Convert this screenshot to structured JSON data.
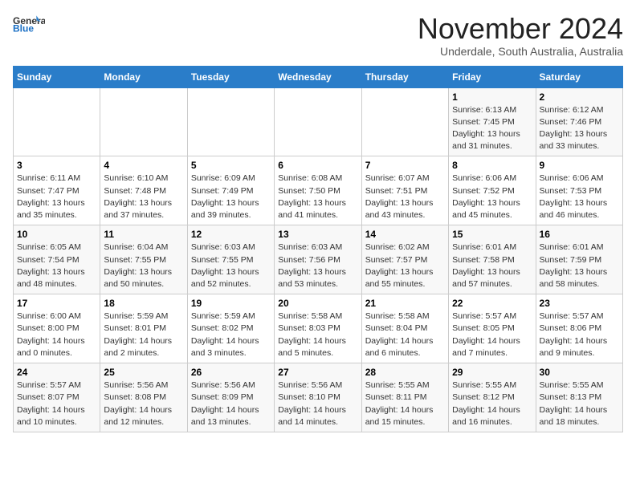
{
  "logo": {
    "general": "General",
    "blue": "Blue"
  },
  "title": "November 2024",
  "subtitle": "Underdale, South Australia, Australia",
  "headers": [
    "Sunday",
    "Monday",
    "Tuesday",
    "Wednesday",
    "Thursday",
    "Friday",
    "Saturday"
  ],
  "weeks": [
    [
      {
        "day": "",
        "detail": ""
      },
      {
        "day": "",
        "detail": ""
      },
      {
        "day": "",
        "detail": ""
      },
      {
        "day": "",
        "detail": ""
      },
      {
        "day": "",
        "detail": ""
      },
      {
        "day": "1",
        "detail": "Sunrise: 6:13 AM\nSunset: 7:45 PM\nDaylight: 13 hours\nand 31 minutes."
      },
      {
        "day": "2",
        "detail": "Sunrise: 6:12 AM\nSunset: 7:46 PM\nDaylight: 13 hours\nand 33 minutes."
      }
    ],
    [
      {
        "day": "3",
        "detail": "Sunrise: 6:11 AM\nSunset: 7:47 PM\nDaylight: 13 hours\nand 35 minutes."
      },
      {
        "day": "4",
        "detail": "Sunrise: 6:10 AM\nSunset: 7:48 PM\nDaylight: 13 hours\nand 37 minutes."
      },
      {
        "day": "5",
        "detail": "Sunrise: 6:09 AM\nSunset: 7:49 PM\nDaylight: 13 hours\nand 39 minutes."
      },
      {
        "day": "6",
        "detail": "Sunrise: 6:08 AM\nSunset: 7:50 PM\nDaylight: 13 hours\nand 41 minutes."
      },
      {
        "day": "7",
        "detail": "Sunrise: 6:07 AM\nSunset: 7:51 PM\nDaylight: 13 hours\nand 43 minutes."
      },
      {
        "day": "8",
        "detail": "Sunrise: 6:06 AM\nSunset: 7:52 PM\nDaylight: 13 hours\nand 45 minutes."
      },
      {
        "day": "9",
        "detail": "Sunrise: 6:06 AM\nSunset: 7:53 PM\nDaylight: 13 hours\nand 46 minutes."
      }
    ],
    [
      {
        "day": "10",
        "detail": "Sunrise: 6:05 AM\nSunset: 7:54 PM\nDaylight: 13 hours\nand 48 minutes."
      },
      {
        "day": "11",
        "detail": "Sunrise: 6:04 AM\nSunset: 7:55 PM\nDaylight: 13 hours\nand 50 minutes."
      },
      {
        "day": "12",
        "detail": "Sunrise: 6:03 AM\nSunset: 7:55 PM\nDaylight: 13 hours\nand 52 minutes."
      },
      {
        "day": "13",
        "detail": "Sunrise: 6:03 AM\nSunset: 7:56 PM\nDaylight: 13 hours\nand 53 minutes."
      },
      {
        "day": "14",
        "detail": "Sunrise: 6:02 AM\nSunset: 7:57 PM\nDaylight: 13 hours\nand 55 minutes."
      },
      {
        "day": "15",
        "detail": "Sunrise: 6:01 AM\nSunset: 7:58 PM\nDaylight: 13 hours\nand 57 minutes."
      },
      {
        "day": "16",
        "detail": "Sunrise: 6:01 AM\nSunset: 7:59 PM\nDaylight: 13 hours\nand 58 minutes."
      }
    ],
    [
      {
        "day": "17",
        "detail": "Sunrise: 6:00 AM\nSunset: 8:00 PM\nDaylight: 14 hours\nand 0 minutes."
      },
      {
        "day": "18",
        "detail": "Sunrise: 5:59 AM\nSunset: 8:01 PM\nDaylight: 14 hours\nand 2 minutes."
      },
      {
        "day": "19",
        "detail": "Sunrise: 5:59 AM\nSunset: 8:02 PM\nDaylight: 14 hours\nand 3 minutes."
      },
      {
        "day": "20",
        "detail": "Sunrise: 5:58 AM\nSunset: 8:03 PM\nDaylight: 14 hours\nand 5 minutes."
      },
      {
        "day": "21",
        "detail": "Sunrise: 5:58 AM\nSunset: 8:04 PM\nDaylight: 14 hours\nand 6 minutes."
      },
      {
        "day": "22",
        "detail": "Sunrise: 5:57 AM\nSunset: 8:05 PM\nDaylight: 14 hours\nand 7 minutes."
      },
      {
        "day": "23",
        "detail": "Sunrise: 5:57 AM\nSunset: 8:06 PM\nDaylight: 14 hours\nand 9 minutes."
      }
    ],
    [
      {
        "day": "24",
        "detail": "Sunrise: 5:57 AM\nSunset: 8:07 PM\nDaylight: 14 hours\nand 10 minutes."
      },
      {
        "day": "25",
        "detail": "Sunrise: 5:56 AM\nSunset: 8:08 PM\nDaylight: 14 hours\nand 12 minutes."
      },
      {
        "day": "26",
        "detail": "Sunrise: 5:56 AM\nSunset: 8:09 PM\nDaylight: 14 hours\nand 13 minutes."
      },
      {
        "day": "27",
        "detail": "Sunrise: 5:56 AM\nSunset: 8:10 PM\nDaylight: 14 hours\nand 14 minutes."
      },
      {
        "day": "28",
        "detail": "Sunrise: 5:55 AM\nSunset: 8:11 PM\nDaylight: 14 hours\nand 15 minutes."
      },
      {
        "day": "29",
        "detail": "Sunrise: 5:55 AM\nSunset: 8:12 PM\nDaylight: 14 hours\nand 16 minutes."
      },
      {
        "day": "30",
        "detail": "Sunrise: 5:55 AM\nSunset: 8:13 PM\nDaylight: 14 hours\nand 18 minutes."
      }
    ]
  ]
}
